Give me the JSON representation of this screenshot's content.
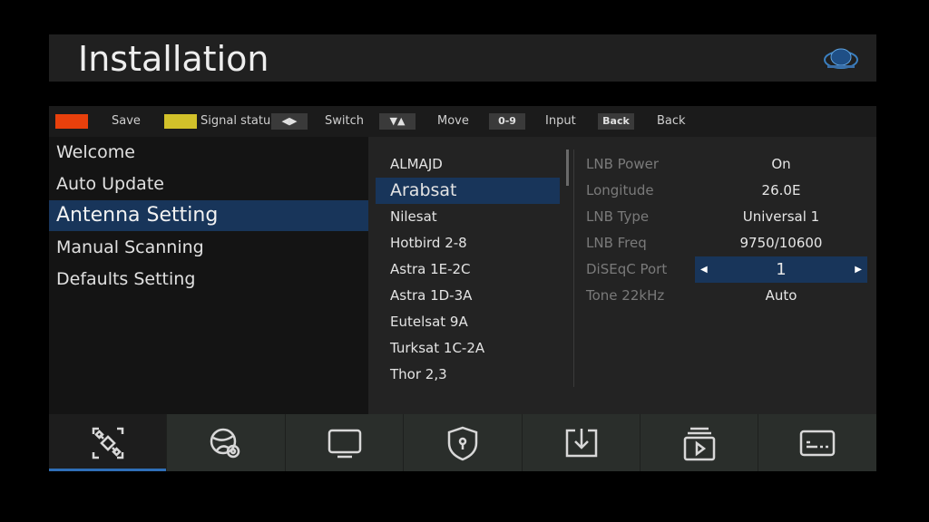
{
  "header": {
    "title": "Installation",
    "logo_icon": "satellite-logo-icon"
  },
  "hints": {
    "save_color": "#e8400c",
    "save_label": "Save",
    "signal_color": "#d2c12a",
    "signal_label": "Signal status",
    "switch_key": "◀▶",
    "switch_label": "Switch",
    "move_key": "▼▲",
    "move_label": "Move",
    "input_key": "0-9",
    "input_label": "Input",
    "back_key": "Back",
    "back_label": "Back"
  },
  "menu": {
    "items": [
      {
        "label": "Welcome"
      },
      {
        "label": "Auto Update"
      },
      {
        "label": "Antenna Setting"
      },
      {
        "label": "Manual Scanning"
      },
      {
        "label": "Defaults Setting"
      }
    ],
    "selected_index": 2
  },
  "satellites": {
    "items": [
      {
        "label": "ALMAJD"
      },
      {
        "label": "Arabsat"
      },
      {
        "label": "Nilesat"
      },
      {
        "label": "Hotbird 2-8"
      },
      {
        "label": "Astra 1E-2C"
      },
      {
        "label": "Astra 1D-3A"
      },
      {
        "label": "Eutelsat 9A"
      },
      {
        "label": "Turksat 1C-2A"
      },
      {
        "label": "Thor 2,3"
      }
    ],
    "selected_index": 1
  },
  "properties": [
    {
      "label": "LNB Power",
      "value": "On"
    },
    {
      "label": "Longitude",
      "value": "26.0E"
    },
    {
      "label": "LNB Type",
      "value": "Universal 1"
    },
    {
      "label": "LNB Freq",
      "value": "9750/10600"
    },
    {
      "label": "DiSEqC Port",
      "value": "1"
    },
    {
      "label": "Tone 22kHz",
      "value": "Auto"
    }
  ],
  "tabs": [
    {
      "icon": "satellite-icon"
    },
    {
      "icon": "network-settings-icon"
    },
    {
      "icon": "monitor-icon"
    },
    {
      "icon": "parental-lock-icon"
    },
    {
      "icon": "download-icon"
    },
    {
      "icon": "media-player-icon"
    },
    {
      "icon": "subtitle-icon"
    }
  ],
  "colors": {
    "accent": "#18355a",
    "tab_underline": "#2f6fb7"
  }
}
